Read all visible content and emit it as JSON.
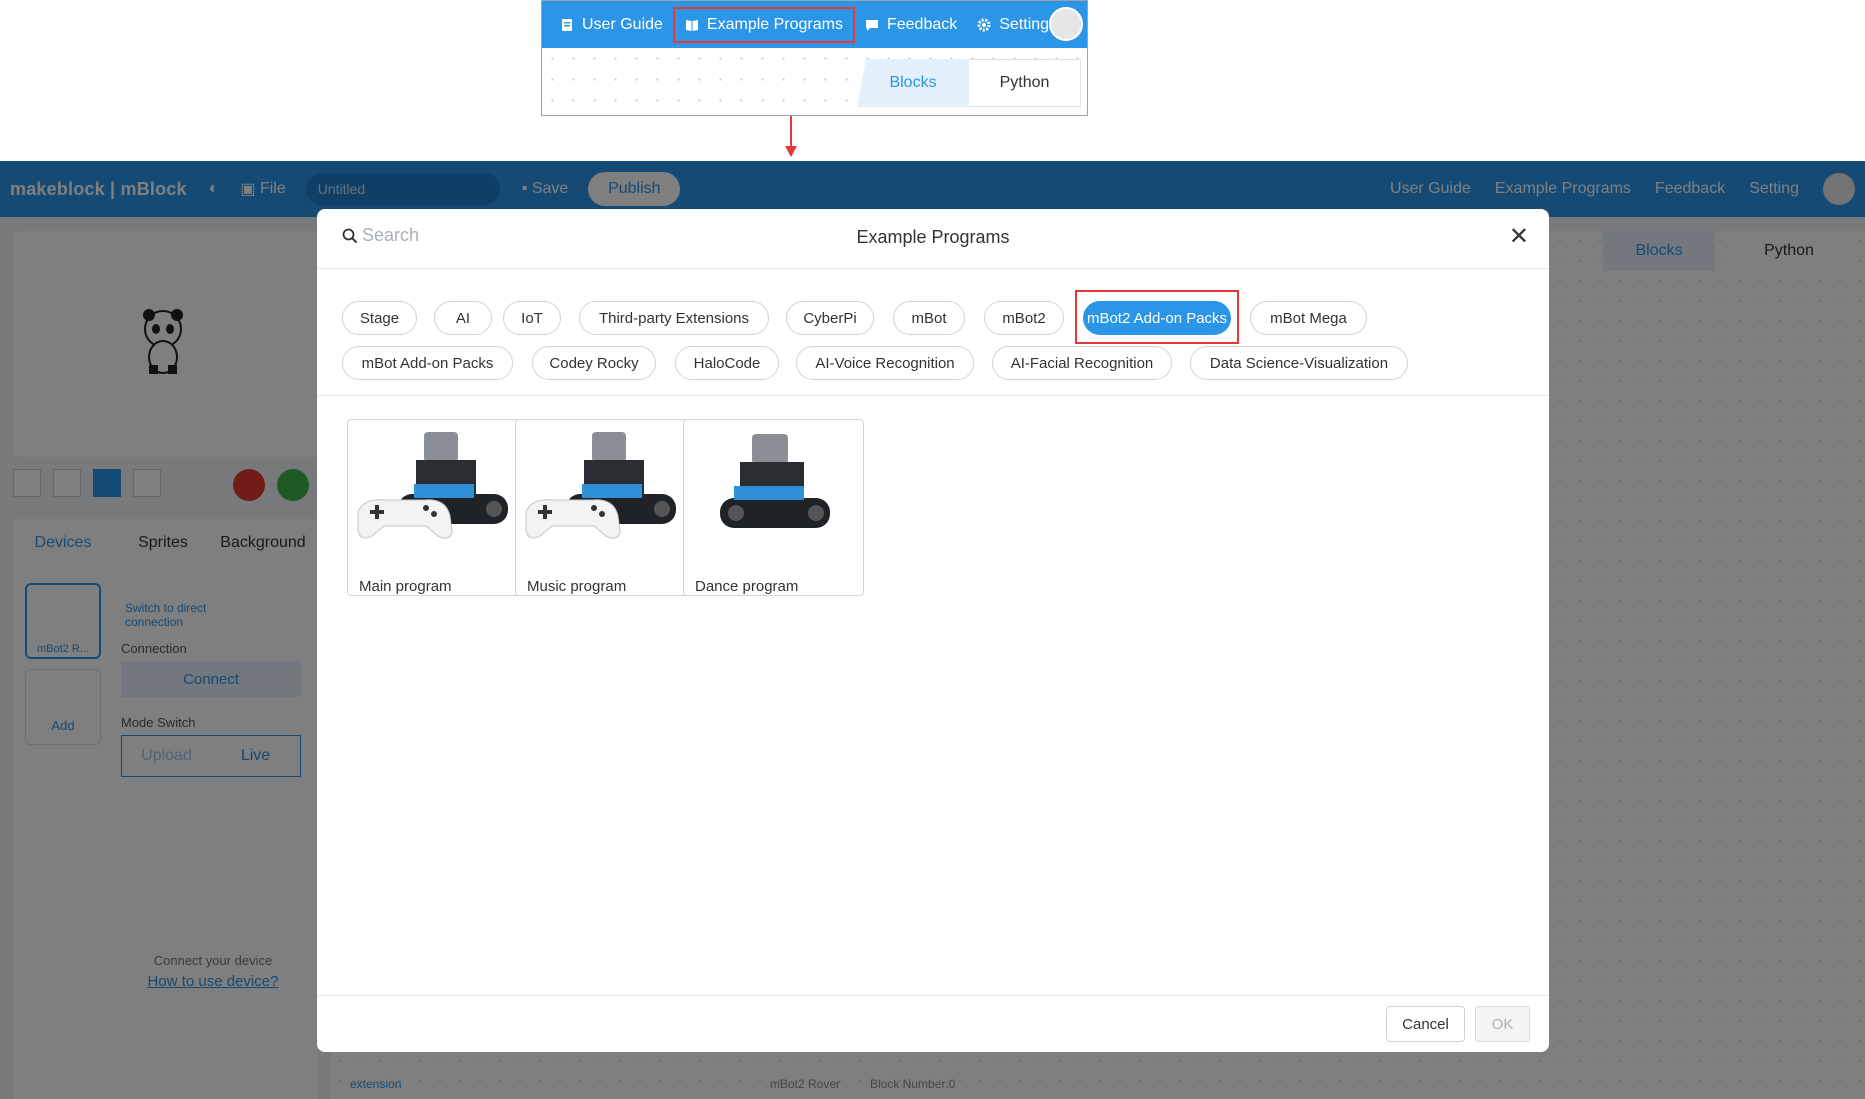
{
  "inset": {
    "items": [
      {
        "label": "User Guide",
        "icon": "book-icon"
      },
      {
        "label": "Example Programs",
        "icon": "open-book-icon"
      },
      {
        "label": "Feedback",
        "icon": "chat-icon"
      },
      {
        "label": "Setting",
        "icon": "gear-icon"
      }
    ],
    "tabs": [
      "Blocks",
      "Python"
    ],
    "highlight_color": "#e53935"
  },
  "app": {
    "logo": "makeblock | mBlock",
    "file": "File",
    "title_value": "Untitled",
    "save": "Save",
    "publish": "Publish",
    "right_items": [
      "User Guide",
      "Example Programs",
      "Feedback",
      "Setting"
    ],
    "right_tabs": [
      "Blocks",
      "Python"
    ],
    "left_tabs": [
      "Devices",
      "Sprites",
      "Background"
    ],
    "device_name": "mBot2 R...",
    "add": "Add",
    "switch_direct": "Switch to direct connection",
    "connection": "Connection",
    "connect": "Connect",
    "mode_switch": "Mode Switch",
    "upload": "Upload",
    "live": "Live",
    "connect_device": "Connect your device",
    "how_to": "How to use device?",
    "extension": "extension",
    "status_left": "mBot2 Rover",
    "status_right": "Block Number:0"
  },
  "modal": {
    "title": "Example Programs",
    "search_placeholder": "Search",
    "categories": [
      "Stage",
      "AI",
      "IoT",
      "Third-party Extensions",
      "CyberPi",
      "mBot",
      "mBot2",
      "mBot2 Add-on Packs",
      "mBot Mega",
      "mBot Add-on Packs",
      "Codey Rocky",
      "HaloCode",
      "AI-Voice Recognition",
      "AI-Facial Recognition",
      "Data Science-Visualization"
    ],
    "active_category": "mBot2 Add-on Packs",
    "programs": [
      {
        "label": "Main program",
        "has_gamepad": true
      },
      {
        "label": "Music program",
        "has_gamepad": true
      },
      {
        "label": "Dance program",
        "has_gamepad": false
      }
    ],
    "cancel": "Cancel",
    "ok": "OK"
  },
  "colors": {
    "accent": "#2b95e8",
    "highlight": "#e53935"
  }
}
